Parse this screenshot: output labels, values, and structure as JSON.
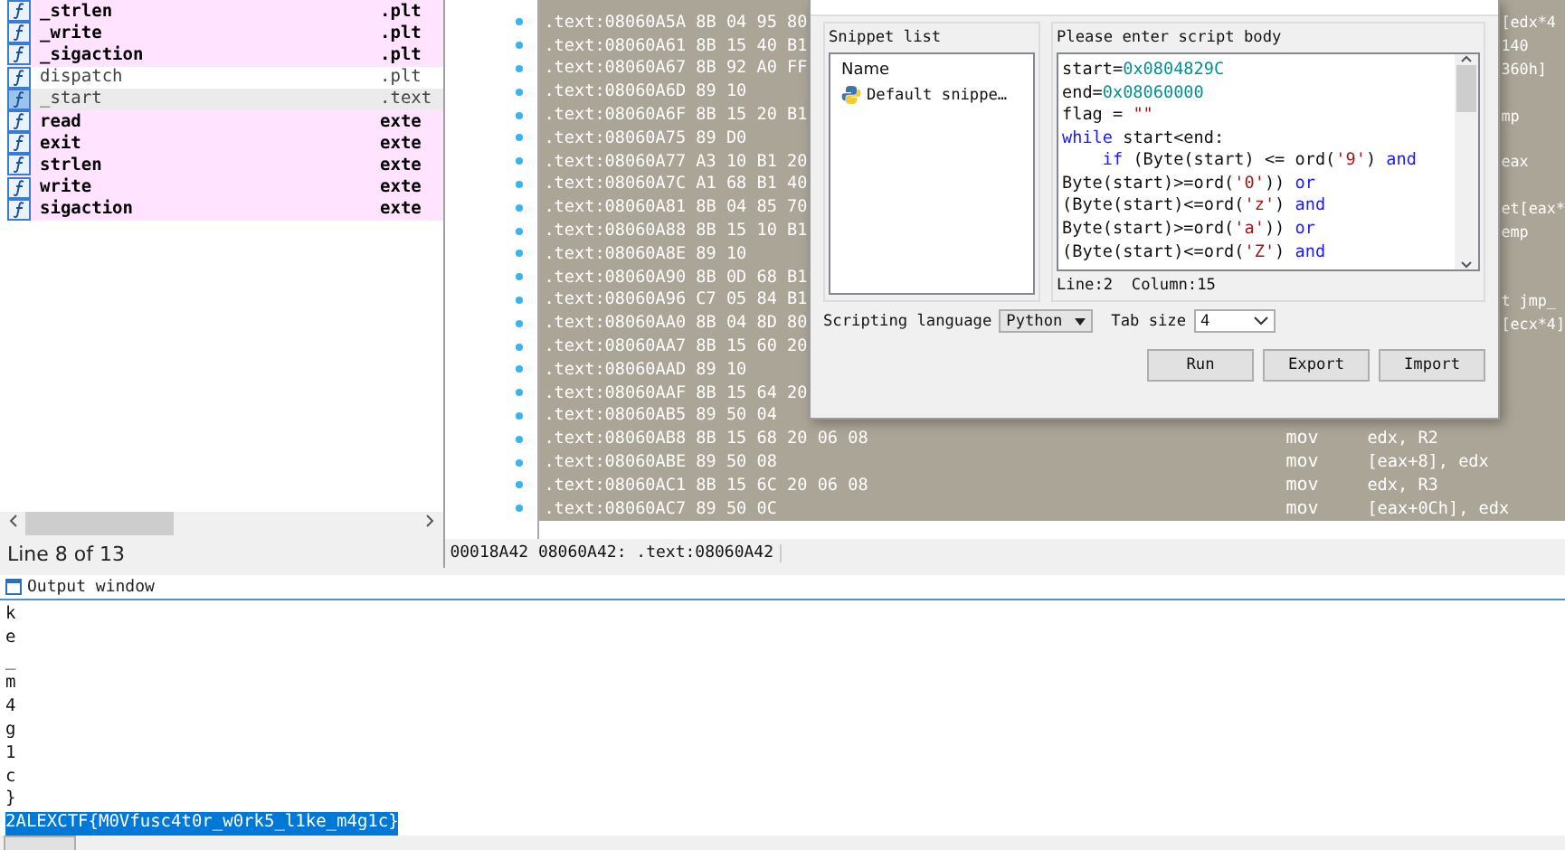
{
  "functions": {
    "rows": [
      {
        "name": "_strlen",
        "segment": ".plt",
        "kind": "import",
        "selected": false
      },
      {
        "name": "_write",
        "segment": ".plt",
        "kind": "import",
        "selected": false
      },
      {
        "name": "_sigaction",
        "segment": ".plt",
        "kind": "import",
        "selected": false
      },
      {
        "name": "dispatch",
        "segment": ".plt",
        "kind": "regular",
        "selected": false
      },
      {
        "name": "_start",
        "segment": ".text",
        "kind": "regular",
        "selected": true
      },
      {
        "name": "read",
        "segment": "exte",
        "kind": "import",
        "selected": false
      },
      {
        "name": "exit",
        "segment": "exte",
        "kind": "import",
        "selected": false
      },
      {
        "name": "strlen",
        "segment": "exte",
        "kind": "import",
        "selected": false
      },
      {
        "name": "write",
        "segment": "exte",
        "kind": "import",
        "selected": false
      },
      {
        "name": "sigaction",
        "segment": "exte",
        "kind": "import",
        "selected": false
      }
    ],
    "status": "Line 8 of 13"
  },
  "disassembly": {
    "rows": [
      {
        "kind": "covered",
        "left": ".text:08060A5A 8B 04 95 80",
        "tail": "[edx*4"
      },
      {
        "kind": "covered",
        "left": ".text:08060A61 8B 15 40 B1",
        "tail": "140"
      },
      {
        "kind": "covered",
        "left": ".text:08060A67 8B 92 A0 FF",
        "tail": "360h]"
      },
      {
        "kind": "covered",
        "left": ".text:08060A6D 89 10"
      },
      {
        "kind": "covered",
        "left": ".text:08060A6F 8B 15 20 B1",
        "tail": "mp"
      },
      {
        "kind": "covered",
        "left": ".text:08060A75 89 D0"
      },
      {
        "kind": "covered",
        "left": ".text:08060A77 A3 10 B1 20",
        "tail": "eax"
      },
      {
        "kind": "covered",
        "left": ".text:08060A7C A1 68 B1 40"
      },
      {
        "kind": "covered",
        "left": ".text:08060A81 8B 04 85 70",
        "tail": "et[eax*"
      },
      {
        "kind": "covered",
        "left": ".text:08060A88 8B 15 10 B1",
        "tail": "emp"
      },
      {
        "kind": "covered",
        "left": ".text:08060A8E 89 10"
      },
      {
        "kind": "covered",
        "left": ".text:08060A90 8B 0D 68 B1"
      },
      {
        "kind": "covered",
        "left": ".text:08060A96 C7 05 84 B1",
        "tail": "t jmp_"
      },
      {
        "kind": "covered",
        "left": ".text:08060AA0 8B 04 8D 80",
        "tail": "[ecx*4]"
      },
      {
        "kind": "covered",
        "left": ".text:08060AA7 8B 15 60 20"
      },
      {
        "kind": "covered",
        "left": ".text:08060AAD 89 10"
      },
      {
        "kind": "covered",
        "left": ".text:08060AAF 8B 15 64 20"
      },
      {
        "kind": "covered",
        "left": ".text:08060AB5 89 50 04"
      },
      {
        "kind": "full",
        "left": ".text:08060AB8 8B 15 68 20 06 08",
        "mnemonic": "mov",
        "operand": "edx, R2"
      },
      {
        "kind": "full",
        "left": ".text:08060ABE 89 50 08",
        "mnemonic": "mov",
        "operand": "[eax+8], edx"
      },
      {
        "kind": "full",
        "left": ".text:08060AC1 8B 15 6C 20 06 08",
        "mnemonic": "mov",
        "operand": "edx, R3"
      },
      {
        "kind": "full",
        "left": ".text:08060AC7 89 50 0C",
        "mnemonic": "mov",
        "operand": "[eax+0Ch], edx"
      }
    ],
    "status": "00018A42 08060A42: .text:08060A42"
  },
  "dialog": {
    "snippet_list": {
      "title": "Snippet list",
      "header": "Name",
      "items": [
        {
          "label": "Default snippe…",
          "selected": false
        }
      ]
    },
    "script": {
      "title": "Please enter script body",
      "lines": [
        [
          {
            "kind": "plain",
            "text": "start="
          },
          {
            "kind": "number",
            "text": "0x0804829C"
          }
        ],
        [
          {
            "kind": "plain",
            "text": "end="
          },
          {
            "kind": "number",
            "text": "0x08060000"
          }
        ],
        [
          {
            "kind": "plain",
            "text": "flag = "
          },
          {
            "kind": "string",
            "text": "\"\""
          }
        ],
        [
          {
            "kind": "keyword",
            "text": "while"
          },
          {
            "kind": "plain",
            "text": " start<end:"
          }
        ],
        [
          {
            "kind": "keyword",
            "text": "    if"
          },
          {
            "kind": "plain",
            "text": " (Byte(start) <= ord("
          },
          {
            "kind": "string",
            "text": "'9'"
          },
          {
            "kind": "plain",
            "text": ") "
          },
          {
            "kind": "keyword",
            "text": "and"
          }
        ],
        [
          {
            "kind": "plain",
            "text": "Byte(start)>=ord("
          },
          {
            "kind": "string",
            "text": "'0'"
          },
          {
            "kind": "plain",
            "text": ")) "
          },
          {
            "kind": "keyword",
            "text": "or"
          }
        ],
        [
          {
            "kind": "plain",
            "text": "(Byte(start)<=ord("
          },
          {
            "kind": "string",
            "text": "'z'"
          },
          {
            "kind": "plain",
            "text": ") "
          },
          {
            "kind": "keyword",
            "text": "and"
          }
        ],
        [
          {
            "kind": "plain",
            "text": "Byte(start)>=ord("
          },
          {
            "kind": "string",
            "text": "'a'"
          },
          {
            "kind": "plain",
            "text": ")) "
          },
          {
            "kind": "keyword",
            "text": "or"
          }
        ],
        [
          {
            "kind": "plain",
            "text": "(Byte(start)<=ord("
          },
          {
            "kind": "string",
            "text": "'Z'"
          },
          {
            "kind": "plain",
            "text": ") "
          },
          {
            "kind": "keyword",
            "text": "and"
          }
        ]
      ],
      "position": "Line:2  Column:15"
    },
    "language": {
      "label": "Scripting language",
      "value": "Python"
    },
    "tab_size": {
      "label": "Tab size",
      "value": "4"
    },
    "buttons": [
      "Run",
      "Export",
      "Import"
    ]
  },
  "output": {
    "title": "Output window",
    "lines": [
      {
        "text": "k",
        "selected": false
      },
      {
        "text": "e",
        "selected": false
      },
      {
        "text": "_",
        "selected": false
      },
      {
        "text": "m",
        "selected": false
      },
      {
        "text": "4",
        "selected": false
      },
      {
        "text": "g",
        "selected": false
      },
      {
        "text": "1",
        "selected": false
      },
      {
        "text": "c",
        "selected": false
      },
      {
        "text": "}",
        "selected": false
      },
      {
        "text": "2ALEXCTF{M0Vfusc4t0r_w0rk5_l1ke_m4g1c}",
        "selected": true
      }
    ]
  }
}
